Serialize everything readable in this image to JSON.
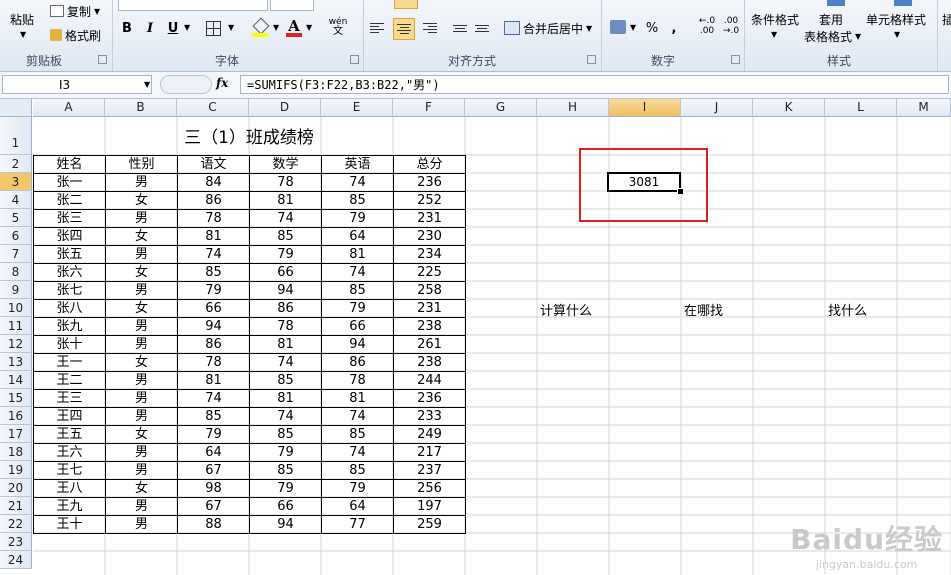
{
  "ribbon": {
    "clipboard": {
      "paste": "粘贴",
      "copy": "复制",
      "format_painter": "格式刷",
      "group": "剪贴板"
    },
    "font": {
      "bold": "B",
      "italic": "I",
      "underline": "U",
      "font_color": "A",
      "phonetic": "wén",
      "group": "字体"
    },
    "alignment": {
      "merge_center": "合并后居中",
      "group": "对齐方式"
    },
    "number": {
      "percent": "%",
      "comma": ",",
      "inc_decimal": "←.0 .00",
      "dec_decimal": ".00 →.0",
      "group": "数字"
    },
    "styles": {
      "conditional": "条件格式",
      "table_format_1": "套用",
      "table_format_2": "表格格式",
      "cell_styles": "单元格样式",
      "group": "样式"
    },
    "insert": "插"
  },
  "formula_bar": {
    "name_box": "I3",
    "fx": "fx",
    "formula": "=SUMIFS(F3:F22,B3:B22,\"男\")"
  },
  "columns": [
    "A",
    "B",
    "C",
    "D",
    "E",
    "F",
    "G",
    "H",
    "I",
    "J",
    "K",
    "L",
    "M"
  ],
  "rows": [
    "1",
    "2",
    "3",
    "4",
    "5",
    "6",
    "7",
    "8",
    "9",
    "10",
    "11",
    "12",
    "13",
    "14",
    "15",
    "16",
    "17",
    "18",
    "19",
    "20",
    "21",
    "22",
    "23",
    "24"
  ],
  "sheet": {
    "title": "三（1）班成绩榜",
    "headers": [
      "姓名",
      "性别",
      "语文",
      "数学",
      "英语",
      "总分"
    ],
    "records": [
      [
        "张一",
        "男",
        "84",
        "78",
        "74",
        "236"
      ],
      [
        "张二",
        "女",
        "86",
        "81",
        "85",
        "252"
      ],
      [
        "张三",
        "男",
        "78",
        "74",
        "79",
        "231"
      ],
      [
        "张四",
        "女",
        "81",
        "85",
        "64",
        "230"
      ],
      [
        "张五",
        "男",
        "74",
        "79",
        "81",
        "234"
      ],
      [
        "张六",
        "女",
        "85",
        "66",
        "74",
        "225"
      ],
      [
        "张七",
        "男",
        "79",
        "94",
        "85",
        "258"
      ],
      [
        "张八",
        "女",
        "66",
        "86",
        "79",
        "231"
      ],
      [
        "张九",
        "男",
        "94",
        "78",
        "66",
        "238"
      ],
      [
        "张十",
        "男",
        "86",
        "81",
        "94",
        "261"
      ],
      [
        "王一",
        "女",
        "78",
        "74",
        "86",
        "238"
      ],
      [
        "王二",
        "男",
        "81",
        "85",
        "78",
        "244"
      ],
      [
        "王三",
        "男",
        "74",
        "81",
        "81",
        "236"
      ],
      [
        "王四",
        "男",
        "85",
        "74",
        "74",
        "233"
      ],
      [
        "王五",
        "女",
        "79",
        "85",
        "85",
        "249"
      ],
      [
        "王六",
        "男",
        "64",
        "79",
        "74",
        "217"
      ],
      [
        "王七",
        "男",
        "67",
        "85",
        "85",
        "237"
      ],
      [
        "王八",
        "女",
        "98",
        "79",
        "79",
        "256"
      ],
      [
        "王九",
        "男",
        "67",
        "66",
        "64",
        "197"
      ],
      [
        "王十",
        "男",
        "88",
        "94",
        "77",
        "259"
      ]
    ],
    "result_value": "3081",
    "label_h10": "计算什么",
    "label_j10": "在哪找",
    "label_l10": "找什么"
  },
  "watermark": {
    "logo": "Baidu经验",
    "url": "jingyan.baidu.com"
  },
  "colors": {
    "selection_border": "#000000",
    "highlight_box": "#e02020",
    "selected_header": "#f5c66a"
  }
}
